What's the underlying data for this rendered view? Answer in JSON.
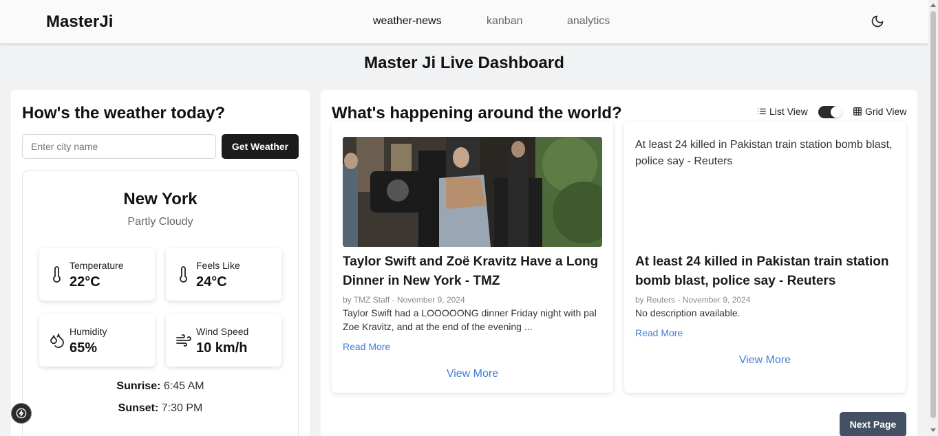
{
  "nav": {
    "brand": "MasterJi",
    "links": [
      "weather-news",
      "kanban",
      "analytics"
    ],
    "active": "weather-news"
  },
  "page_title": "Master Ji Live Dashboard",
  "weather": {
    "heading": "How's the weather today?",
    "input_placeholder": "Enter city name",
    "button_label": "Get Weather",
    "city": "New York",
    "condition": "Partly Cloudy",
    "stats": [
      {
        "label": "Temperature",
        "value": "22°C",
        "icon": "thermometer-icon"
      },
      {
        "label": "Feels Like",
        "value": "24°C",
        "icon": "thermometer-icon"
      },
      {
        "label": "Humidity",
        "value": "65%",
        "icon": "droplets-icon"
      },
      {
        "label": "Wind Speed",
        "value": "10 km/h",
        "icon": "wind-icon"
      }
    ],
    "sunrise_label": "Sunrise:",
    "sunrise": "6:45 AM",
    "sunset_label": "Sunset:",
    "sunset": "7:30 PM"
  },
  "news": {
    "heading": "What's happening around the world?",
    "list_view_label": "List View",
    "grid_view_label": "Grid View",
    "grid_view_enabled": true,
    "articles": [
      {
        "title": "Taylor Swift and Zoë Kravitz Have a Long Dinner in New York - TMZ",
        "meta": "by TMZ Staff - November 9, 2024",
        "description": "Taylor Swift had a LOOOOONG dinner Friday night with pal Zoe Kravitz, and at the end of the evening ...",
        "image_alt": "",
        "read_more": "Read More",
        "view_more": "View More"
      },
      {
        "title": "At least 24 killed in Pakistan train station bomb blast, police say - Reuters",
        "meta": "by Reuters - November 9, 2024",
        "description": "No description available.",
        "image_alt": "At least 24 killed in Pakistan train station bomb blast, police say - Reuters",
        "read_more": "Read More",
        "view_more": "View More"
      }
    ],
    "next_page_label": "Next Page"
  },
  "colors": {
    "accent_link": "#3b7dd8",
    "primary_button": "#1c1c1c",
    "next_button": "#445063",
    "page_background": "#f1f2f4"
  }
}
